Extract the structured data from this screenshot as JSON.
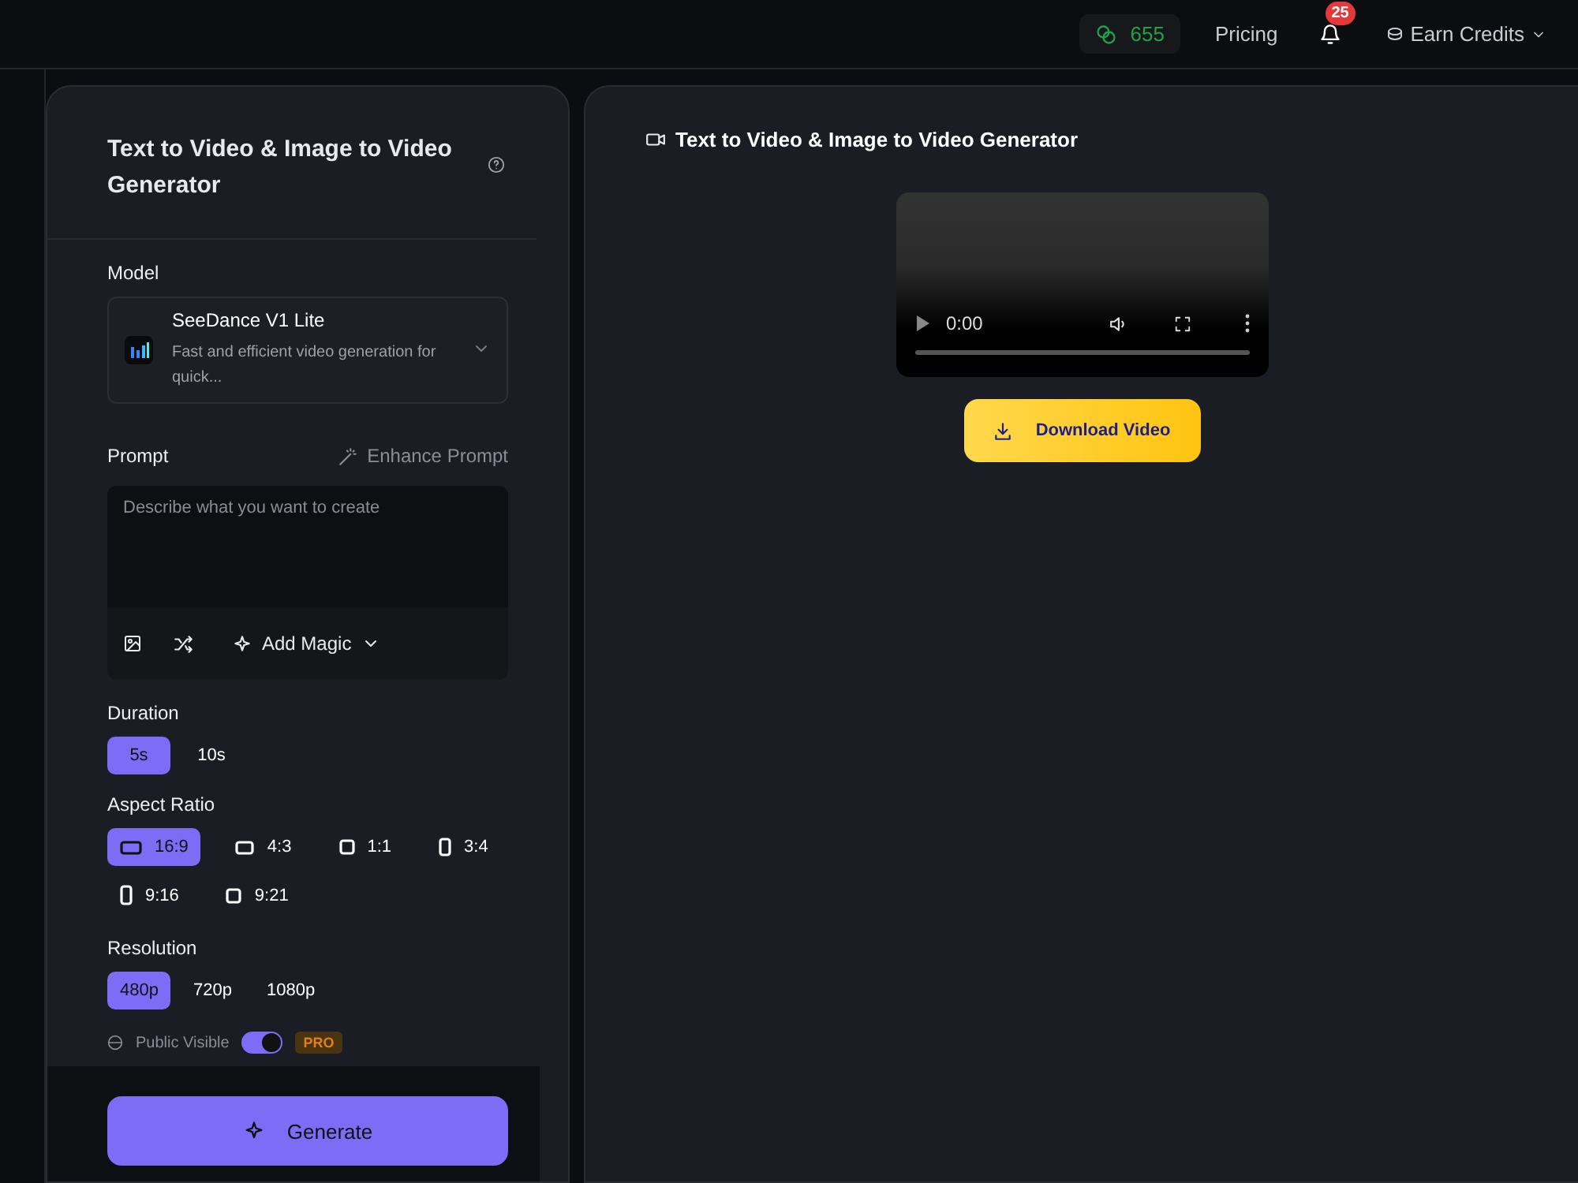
{
  "top_bar": {
    "credits": "655",
    "pricing": "Pricing",
    "notifications": "25",
    "earn": "Earn Credits"
  },
  "form": {
    "title": "Text to Video & Image to Video Generator",
    "model_label": "Model",
    "model": {
      "name": "SeeDance V1 Lite",
      "description": "Fast and efficient video generation for quick..."
    },
    "prompt_label": "Prompt",
    "enhance": "Enhance Prompt",
    "prompt": {
      "placeholder": "Describe what you want to create"
    },
    "add_magic": "Add Magic",
    "duration_label": "Duration",
    "durations": [
      {
        "label": "5s",
        "selected": true
      },
      {
        "label": "10s",
        "selected": false
      }
    ],
    "aspect_label": "Aspect Ratio",
    "aspects": [
      {
        "label": "16:9",
        "kind": "wide",
        "selected": true
      },
      {
        "label": "4:3",
        "kind": "landscape",
        "selected": false
      },
      {
        "label": "1:1",
        "kind": "square",
        "selected": false
      },
      {
        "label": "3:4",
        "kind": "portrait",
        "selected": false
      },
      {
        "label": "9:16",
        "kind": "tall",
        "selected": false
      },
      {
        "label": "9:21",
        "kind": "square",
        "selected": false
      }
    ],
    "resolution_label": "Resolution",
    "resolutions": [
      {
        "label": "480p",
        "selected": true
      },
      {
        "label": "720p",
        "selected": false
      },
      {
        "label": "1080p",
        "selected": false
      }
    ],
    "public": {
      "label": "Public Visible",
      "on": true,
      "badge": "PRO"
    },
    "generate": "Generate"
  },
  "preview": {
    "title": "Text to Video & Image to Video Generator",
    "time": "0:00",
    "download": "Download Video"
  }
}
